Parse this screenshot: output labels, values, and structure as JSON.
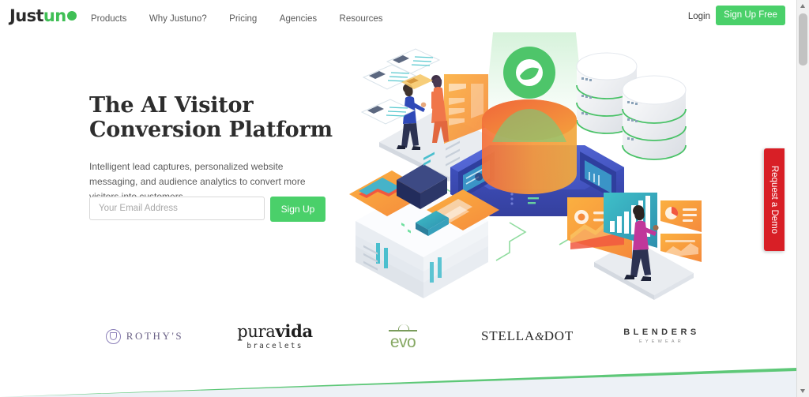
{
  "header": {
    "logo": {
      "part1": "Just",
      "part2": "un",
      "icon": "justuno-dot-icon"
    },
    "nav": [
      {
        "label": "Products"
      },
      {
        "label": "Why Justuno?"
      },
      {
        "label": "Pricing"
      },
      {
        "label": "Agencies"
      },
      {
        "label": "Resources"
      }
    ],
    "login_label": "Login",
    "signup_label": "Sign Up Free"
  },
  "hero": {
    "title_line1": "The AI Visitor",
    "title_line2": "Conversion Platform",
    "subtitle": "Intelligent lead captures, personalized website messaging, and audience analytics to convert more visitors into customers.",
    "email_placeholder": "Your Email Address",
    "email_value": "",
    "submit_label": "Sign Up"
  },
  "brands": [
    {
      "name": "rothys",
      "text": "ROTHY'S"
    },
    {
      "name": "puravida",
      "text_light": "pura",
      "text_bold": "vida",
      "sub": "bracelets"
    },
    {
      "name": "evo",
      "text": "evo"
    },
    {
      "name": "stella-dot",
      "text_before": "STELLA",
      "amp": "&",
      "text_after": "DOT"
    },
    {
      "name": "blenders",
      "text": "BLENDERS",
      "sub": "EYEWEAR"
    }
  ],
  "demo_tab": {
    "label": "Request a Demo"
  },
  "colors": {
    "brand_green": "#4ad06a",
    "logo_green": "#3fbf55",
    "demo_red": "#d81f26",
    "heading_dark": "#2d2d2d",
    "body_gray": "#5c5c5c",
    "divider_green": "#5ec878"
  }
}
